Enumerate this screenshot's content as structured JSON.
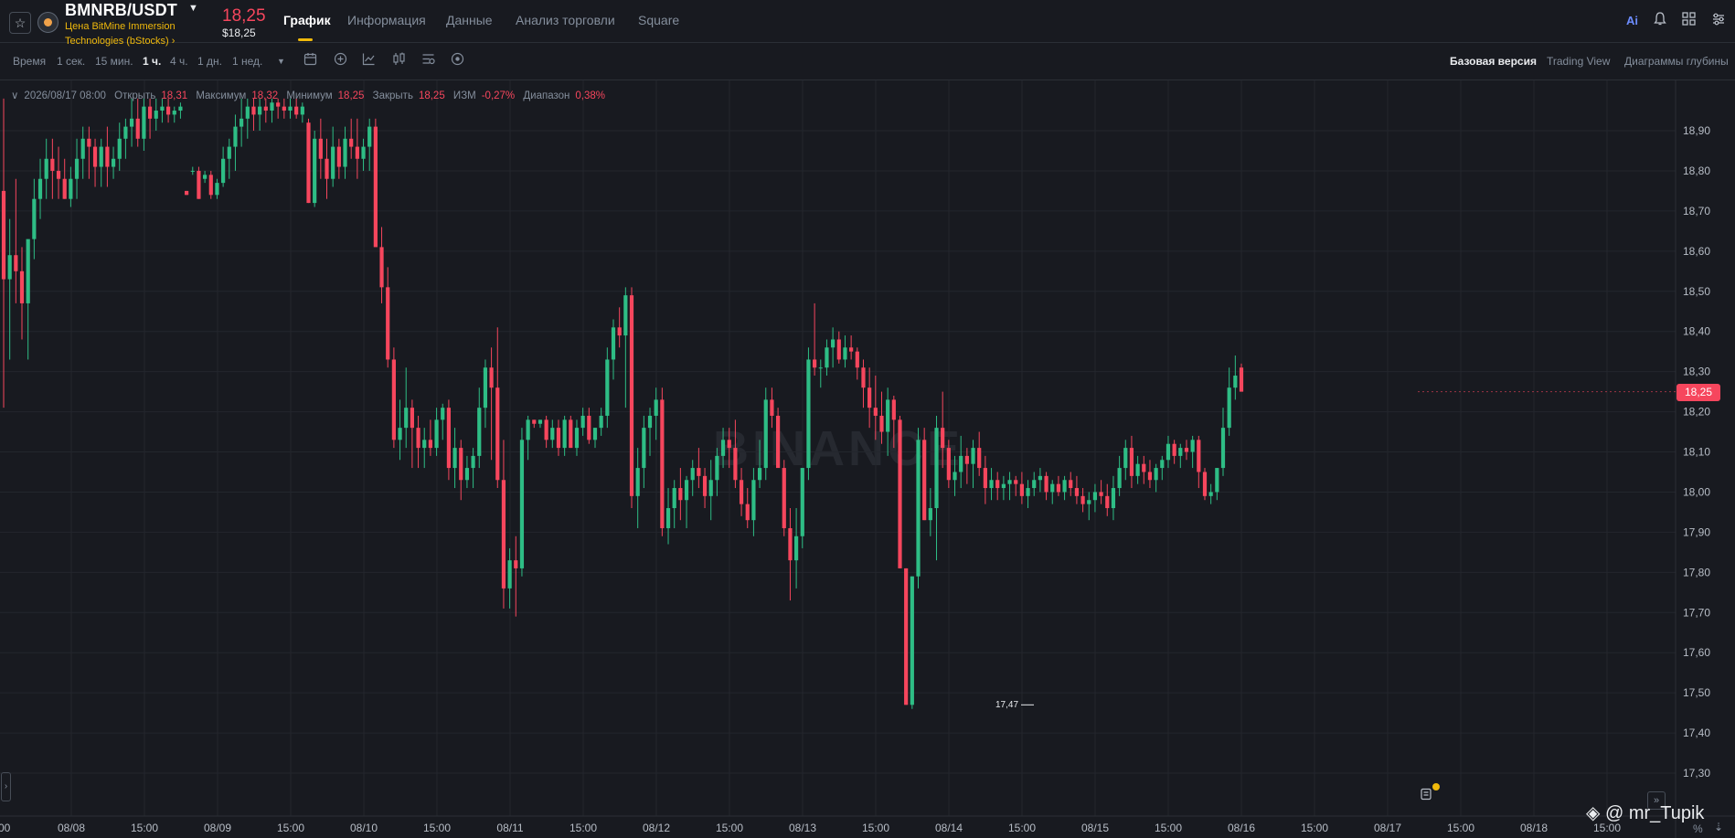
{
  "header": {
    "pair": "BMNRB/USDT",
    "coin_name": "Цена BitMine Immersion Technologies (bStocks)",
    "coin_name_suffix": "›",
    "price": "18,25",
    "price_usd": "$18,25",
    "tabs": [
      "График",
      "Информация",
      "Данные",
      "Анализ торговли",
      "Square"
    ],
    "active_tab": "График",
    "ai_label": "Ai"
  },
  "toolbar": {
    "time_label": "Время",
    "intervals": [
      "1 сек.",
      "15 мин.",
      "1 ч.",
      "4 ч.",
      "1 дн.",
      "1 нед."
    ],
    "active_interval": "1 ч.",
    "views": [
      "Базовая версия",
      "Trading View",
      "Диаграммы глубины"
    ],
    "active_view": "Базовая версия"
  },
  "ohlc": {
    "date": "2026/08/17 08:00",
    "open_label": "Открыть",
    "open_value": "18,31",
    "high_label": "Максимум",
    "high_value": "18,32",
    "low_label": "Минимум",
    "low_value": "18,25",
    "close_label": "Закрыть",
    "close_value": "18,25",
    "change_label": "ИЗМ",
    "change_value": "-0,27%",
    "range_label": "Диапазон",
    "range_value": "0,38%"
  },
  "colors": {
    "up": "#2ebd85",
    "down": "#f6465d",
    "accent": "#f0b90b",
    "grid": "#23262d"
  },
  "chart_data": {
    "type": "candlestick",
    "ylim": [
      17.22,
      18.98
    ],
    "y_ticks": [
      "18,90",
      "18,80",
      "18,70",
      "18,60",
      "18,50",
      "18,40",
      "18,30",
      "18,20",
      "18,10",
      "18,00",
      "17,90",
      "17,80",
      "17,70",
      "17,60",
      "17,50",
      "17,40",
      "17,30"
    ],
    "x_ticks": [
      "00",
      "08/08",
      "15:00",
      "08/09",
      "15:00",
      "08/10",
      "15:00",
      "08/11",
      "15:00",
      "08/12",
      "15:00",
      "08/13",
      "15:00",
      "08/14",
      "15:00",
      "08/15",
      "15:00",
      "08/16",
      "15:00",
      "08/17",
      "15:00",
      "08/18",
      "15:00"
    ],
    "current_price": "18,25",
    "min_marker": "17,47",
    "candles": [
      [
        18.75,
        18.98,
        18.21,
        18.53
      ],
      [
        18.53,
        18.68,
        18.33,
        18.59
      ],
      [
        18.59,
        18.78,
        18.47,
        18.55
      ],
      [
        18.55,
        18.61,
        18.38,
        18.47
      ],
      [
        18.47,
        18.58,
        18.33,
        18.63
      ],
      [
        18.63,
        18.78,
        18.58,
        18.73
      ],
      [
        18.73,
        18.83,
        18.68,
        18.78
      ],
      [
        18.78,
        18.88,
        18.73,
        18.83
      ],
      [
        18.83,
        18.88,
        18.73,
        18.8
      ],
      [
        18.8,
        18.86,
        18.73,
        18.78
      ],
      [
        18.78,
        18.83,
        18.73,
        18.73
      ],
      [
        18.73,
        18.81,
        18.71,
        18.78
      ],
      [
        18.78,
        18.88,
        18.73,
        18.83
      ],
      [
        18.83,
        18.91,
        18.78,
        18.88
      ],
      [
        18.88,
        18.91,
        18.78,
        18.86
      ],
      [
        18.86,
        18.88,
        18.76,
        18.81
      ],
      [
        18.81,
        18.88,
        18.76,
        18.86
      ],
      [
        18.86,
        18.91,
        18.76,
        18.81
      ],
      [
        18.81,
        18.86,
        18.78,
        18.83
      ],
      [
        18.83,
        18.92,
        18.8,
        18.88
      ],
      [
        18.88,
        18.93,
        18.83,
        18.91
      ],
      [
        18.91,
        18.98,
        18.86,
        18.93
      ],
      [
        18.93,
        18.98,
        18.86,
        18.88
      ],
      [
        18.88,
        18.98,
        18.85,
        18.96
      ],
      [
        18.96,
        18.98,
        18.88,
        18.93
      ],
      [
        18.93,
        18.98,
        18.9,
        18.95
      ],
      [
        18.95,
        18.98,
        18.92,
        18.96
      ],
      [
        18.96,
        18.98,
        18.92,
        18.94
      ],
      [
        18.94,
        18.96,
        18.92,
        18.95
      ],
      [
        18.95,
        18.97,
        18.93,
        18.96
      ],
      [
        18.75,
        18.75,
        18.74,
        18.74
      ],
      [
        18.8,
        18.81,
        18.79,
        18.8
      ],
      [
        18.8,
        18.81,
        18.73,
        18.73
      ],
      [
        18.78,
        18.8,
        18.77,
        18.79
      ],
      [
        18.79,
        18.8,
        18.73,
        18.74
      ],
      [
        18.74,
        18.78,
        18.73,
        18.77
      ],
      [
        18.77,
        18.86,
        18.76,
        18.83
      ],
      [
        18.83,
        18.88,
        18.78,
        18.86
      ],
      [
        18.86,
        18.94,
        18.8,
        18.91
      ],
      [
        18.91,
        18.98,
        18.86,
        18.93
      ],
      [
        18.93,
        18.98,
        18.88,
        18.96
      ],
      [
        18.96,
        18.98,
        18.9,
        18.94
      ],
      [
        18.94,
        18.98,
        18.9,
        18.96
      ],
      [
        18.96,
        18.98,
        18.92,
        18.95
      ],
      [
        18.95,
        18.98,
        18.92,
        18.97
      ],
      [
        18.97,
        18.98,
        18.93,
        18.96
      ],
      [
        18.96,
        18.98,
        18.93,
        18.95
      ],
      [
        18.95,
        18.98,
        18.93,
        18.96
      ],
      [
        18.96,
        18.98,
        18.93,
        18.94
      ],
      [
        18.94,
        18.97,
        18.92,
        18.96
      ],
      [
        18.92,
        18.93,
        18.72,
        18.72
      ],
      [
        18.72,
        18.9,
        18.71,
        18.88
      ],
      [
        18.88,
        18.93,
        18.78,
        18.83
      ],
      [
        18.83,
        18.88,
        18.73,
        18.78
      ],
      [
        18.78,
        18.91,
        18.76,
        18.86
      ],
      [
        18.86,
        18.88,
        18.78,
        18.81
      ],
      [
        18.81,
        18.91,
        18.78,
        18.88
      ],
      [
        18.88,
        18.93,
        18.83,
        18.86
      ],
      [
        18.86,
        18.93,
        18.78,
        18.83
      ],
      [
        18.83,
        18.88,
        18.8,
        18.86
      ],
      [
        18.86,
        18.93,
        18.8,
        18.91
      ],
      [
        18.91,
        18.93,
        18.68,
        18.61
      ],
      [
        18.61,
        18.66,
        18.47,
        18.51
      ],
      [
        18.51,
        18.56,
        18.31,
        18.33
      ],
      [
        18.33,
        18.36,
        18.11,
        18.13
      ],
      [
        18.13,
        18.23,
        18.08,
        18.16
      ],
      [
        18.16,
        18.31,
        18.11,
        18.21
      ],
      [
        18.21,
        18.23,
        18.06,
        18.16
      ],
      [
        18.16,
        18.19,
        18.06,
        18.11
      ],
      [
        18.11,
        18.16,
        18.06,
        18.13
      ],
      [
        18.13,
        18.18,
        18.09,
        18.11
      ],
      [
        18.11,
        18.21,
        18.09,
        18.18
      ],
      [
        18.18,
        18.22,
        18.13,
        18.21
      ],
      [
        18.21,
        18.23,
        18.03,
        18.06
      ],
      [
        18.06,
        18.16,
        18.01,
        18.11
      ],
      [
        18.11,
        18.13,
        17.98,
        18.03
      ],
      [
        18.03,
        18.09,
        18.01,
        18.06
      ],
      [
        18.06,
        18.11,
        18.01,
        18.09
      ],
      [
        18.09,
        18.26,
        18.06,
        18.21
      ],
      [
        18.21,
        18.33,
        18.16,
        18.31
      ],
      [
        18.31,
        18.36,
        18.08,
        18.26
      ],
      [
        18.26,
        18.41,
        18.01,
        18.03
      ],
      [
        18.03,
        18.13,
        17.71,
        17.76
      ],
      [
        17.76,
        17.86,
        17.71,
        17.83
      ],
      [
        17.83,
        17.89,
        17.69,
        17.81
      ],
      [
        17.81,
        18.16,
        17.79,
        18.13
      ],
      [
        18.13,
        18.19,
        18.08,
        18.18
      ],
      [
        18.18,
        18.18,
        18.16,
        18.17
      ],
      [
        18.17,
        18.18,
        18.16,
        18.18
      ],
      [
        18.18,
        18.19,
        18.11,
        18.13
      ],
      [
        18.13,
        18.18,
        18.11,
        18.16
      ],
      [
        18.16,
        18.18,
        18.09,
        18.11
      ],
      [
        18.11,
        18.19,
        18.09,
        18.18
      ],
      [
        18.18,
        18.19,
        18.11,
        18.11
      ],
      [
        18.11,
        18.18,
        18.09,
        18.16
      ],
      [
        18.16,
        18.21,
        18.14,
        18.19
      ],
      [
        18.19,
        18.21,
        18.12,
        18.13
      ],
      [
        18.13,
        18.16,
        18.11,
        18.16
      ],
      [
        18.16,
        18.21,
        18.14,
        18.19
      ],
      [
        18.19,
        18.36,
        18.16,
        18.33
      ],
      [
        18.33,
        18.43,
        18.28,
        18.41
      ],
      [
        18.41,
        18.46,
        18.36,
        18.39
      ],
      [
        18.39,
        18.51,
        18.21,
        18.49
      ],
      [
        18.49,
        18.51,
        17.96,
        17.99
      ],
      [
        17.99,
        18.11,
        17.91,
        18.06
      ],
      [
        18.06,
        18.19,
        18.01,
        18.16
      ],
      [
        18.16,
        18.21,
        18.09,
        18.19
      ],
      [
        18.19,
        18.26,
        18.13,
        18.23
      ],
      [
        18.23,
        18.26,
        17.89,
        17.91
      ],
      [
        17.91,
        18.01,
        17.87,
        17.96
      ],
      [
        17.96,
        18.03,
        17.91,
        18.01
      ],
      [
        18.01,
        18.06,
        17.93,
        17.98
      ],
      [
        17.98,
        18.04,
        17.91,
        18.03
      ],
      [
        18.03,
        18.08,
        17.99,
        18.06
      ],
      [
        18.06,
        18.11,
        18.01,
        18.04
      ],
      [
        18.04,
        18.06,
        17.96,
        17.99
      ],
      [
        17.99,
        18.08,
        17.93,
        18.03
      ],
      [
        18.03,
        18.11,
        17.99,
        18.09
      ],
      [
        18.09,
        18.16,
        18.06,
        18.13
      ],
      [
        18.13,
        18.16,
        18.06,
        18.11
      ],
      [
        18.11,
        18.18,
        18.01,
        18.03
      ],
      [
        18.03,
        18.06,
        17.94,
        17.97
      ],
      [
        17.97,
        18.01,
        17.91,
        17.93
      ],
      [
        17.93,
        18.06,
        17.89,
        18.03
      ],
      [
        18.03,
        18.13,
        18.01,
        18.06
      ],
      [
        18.06,
        18.26,
        18.03,
        18.23
      ],
      [
        18.23,
        18.26,
        18.16,
        18.19
      ],
      [
        18.19,
        18.21,
        18.11,
        18.06
      ],
      [
        18.06,
        18.08,
        17.89,
        17.91
      ],
      [
        17.91,
        17.96,
        17.73,
        17.83
      ],
      [
        17.83,
        17.96,
        17.76,
        17.89
      ],
      [
        17.89,
        18.06,
        17.86,
        18.06
      ],
      [
        18.06,
        18.36,
        18.03,
        18.33
      ],
      [
        18.33,
        18.47,
        18.29,
        18.31
      ],
      [
        18.31,
        18.33,
        18.26,
        18.31
      ],
      [
        18.31,
        18.38,
        18.29,
        18.36
      ],
      [
        18.36,
        18.41,
        18.31,
        18.38
      ],
      [
        18.38,
        18.4,
        18.32,
        18.33
      ],
      [
        18.33,
        18.39,
        18.31,
        18.36
      ],
      [
        18.36,
        18.39,
        18.33,
        18.35
      ],
      [
        18.35,
        18.36,
        18.28,
        18.31
      ],
      [
        18.31,
        18.33,
        18.21,
        18.26
      ],
      [
        18.26,
        18.31,
        18.16,
        18.21
      ],
      [
        18.21,
        18.29,
        18.13,
        18.19
      ],
      [
        18.19,
        18.25,
        18.12,
        18.15
      ],
      [
        18.15,
        18.26,
        18.09,
        18.23
      ],
      [
        18.23,
        18.24,
        18.11,
        18.18
      ],
      [
        18.18,
        18.19,
        17.81,
        17.81
      ],
      [
        17.81,
        17.81,
        17.47,
        17.47
      ],
      [
        17.47,
        17.79,
        17.46,
        17.79
      ],
      [
        17.79,
        18.16,
        17.76,
        18.13
      ],
      [
        18.13,
        18.16,
        17.93,
        17.93
      ],
      [
        17.93,
        18.01,
        17.89,
        17.96
      ],
      [
        17.96,
        18.19,
        17.83,
        18.16
      ],
      [
        18.16,
        18.25,
        18.06,
        18.11
      ],
      [
        18.11,
        18.13,
        18.01,
        18.03
      ],
      [
        18.03,
        18.09,
        17.99,
        18.05
      ],
      [
        18.05,
        18.14,
        18.01,
        18.09
      ],
      [
        18.09,
        18.11,
        18.02,
        18.07
      ],
      [
        18.07,
        18.13,
        18.01,
        18.11
      ],
      [
        18.11,
        18.15,
        18.04,
        18.06
      ],
      [
        18.06,
        18.09,
        17.97,
        18.01
      ],
      [
        18.01,
        18.06,
        17.98,
        18.03
      ],
      [
        18.03,
        18.05,
        17.98,
        18.01
      ],
      [
        18.01,
        18.04,
        17.98,
        18.02
      ],
      [
        18.02,
        18.05,
        17.98,
        18.03
      ],
      [
        18.03,
        18.04,
        17.99,
        18.02
      ],
      [
        18.02,
        18.05,
        17.97,
        17.99
      ],
      [
        17.99,
        18.03,
        17.96,
        18.01
      ],
      [
        18.01,
        18.05,
        17.99,
        18.03
      ],
      [
        18.03,
        18.06,
        18.0,
        18.04
      ],
      [
        18.04,
        18.05,
        17.98,
        18.0
      ],
      [
        18.0,
        18.03,
        17.97,
        18.02
      ],
      [
        18.02,
        18.04,
        17.99,
        18.0
      ],
      [
        18.0,
        18.04,
        17.98,
        18.03
      ],
      [
        18.03,
        18.05,
        17.99,
        18.01
      ],
      [
        18.01,
        18.04,
        17.97,
        17.99
      ],
      [
        17.99,
        18.01,
        17.95,
        17.97
      ],
      [
        17.97,
        18.0,
        17.93,
        17.98
      ],
      [
        17.98,
        18.02,
        17.95,
        18.0
      ],
      [
        18.0,
        18.03,
        17.97,
        17.99
      ],
      [
        17.99,
        18.02,
        17.94,
        17.96
      ],
      [
        17.96,
        18.04,
        17.93,
        18.01
      ],
      [
        18.01,
        18.09,
        17.99,
        18.06
      ],
      [
        18.06,
        18.13,
        18.03,
        18.11
      ],
      [
        18.11,
        18.14,
        18.01,
        18.04
      ],
      [
        18.04,
        18.09,
        18.02,
        18.07
      ],
      [
        18.07,
        18.09,
        18.02,
        18.05
      ],
      [
        18.05,
        18.08,
        18.01,
        18.03
      ],
      [
        18.03,
        18.07,
        18.0,
        18.06
      ],
      [
        18.06,
        18.09,
        18.03,
        18.08
      ],
      [
        18.08,
        18.14,
        18.06,
        18.12
      ],
      [
        18.12,
        18.13,
        18.07,
        18.09
      ],
      [
        18.09,
        18.12,
        18.06,
        18.11
      ],
      [
        18.11,
        18.13,
        18.08,
        18.1
      ],
      [
        18.1,
        18.14,
        18.06,
        18.13
      ],
      [
        18.13,
        18.14,
        18.01,
        18.05
      ],
      [
        18.05,
        18.06,
        17.98,
        17.99
      ],
      [
        17.99,
        18.02,
        17.97,
        18.0
      ],
      [
        18.0,
        18.06,
        17.98,
        18.06
      ],
      [
        18.06,
        18.21,
        18.04,
        18.16
      ],
      [
        18.16,
        18.31,
        18.14,
        18.26
      ],
      [
        18.26,
        18.34,
        18.23,
        18.29
      ],
      [
        18.31,
        18.32,
        18.25,
        18.25
      ]
    ]
  },
  "watermark": "@ mr_Tupik",
  "brand": "BINANCE"
}
